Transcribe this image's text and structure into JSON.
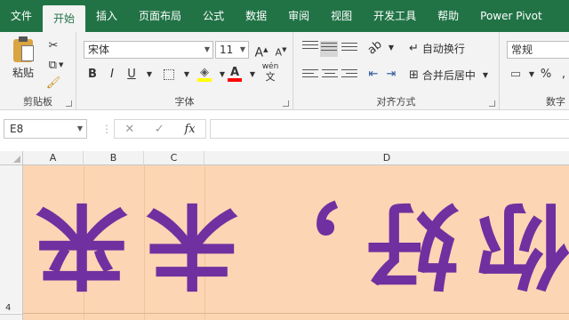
{
  "tabs": [
    "文件",
    "开始",
    "插入",
    "页面布局",
    "公式",
    "数据",
    "审阅",
    "视图",
    "开发工具",
    "帮助",
    "Power Pivot"
  ],
  "active_tab": "开始",
  "clipboard": {
    "paste_label": "粘贴",
    "group_label": "剪贴板"
  },
  "font": {
    "name": "宋体",
    "size": "11",
    "group_label": "字体",
    "bold": "B",
    "italic": "I",
    "underline": "U",
    "grow": "A",
    "shrink": "A",
    "phonetic": "wén"
  },
  "alignment": {
    "wrap_text": "自动换行",
    "merge_center": "合并后居中",
    "group_label": "对齐方式"
  },
  "number": {
    "format": "常规",
    "group_label": "数字",
    "percent": "%"
  },
  "formula_bar": {
    "cell_ref": "E8",
    "fx": "fx",
    "cancel": "✕",
    "enter": "✓",
    "value": ""
  },
  "columns": [
    "A",
    "B",
    "C",
    "D"
  ],
  "rows": [
    "4"
  ],
  "cell_content": "你好，未来",
  "colors": {
    "ribbon_green": "#217346",
    "cell_fill": "#fcd5b4",
    "text_color": "#7030a0",
    "highlight": "#ffff00",
    "font_color": "#ff0000"
  }
}
